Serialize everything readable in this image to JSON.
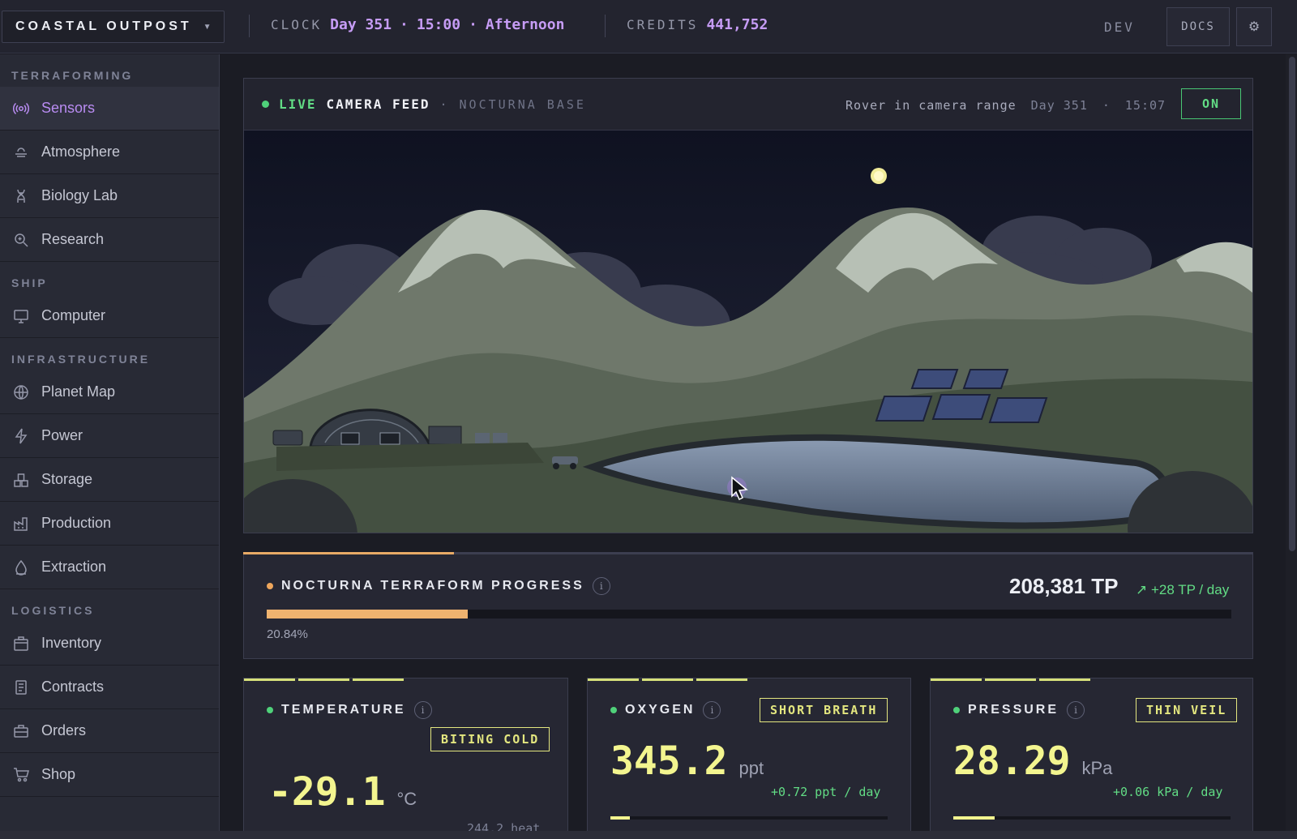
{
  "header": {
    "outpost_name": "COASTAL OUTPOST",
    "clock_label": "CLOCK",
    "clock_day": "Day 351",
    "clock_time": "15:00",
    "clock_period": "Afternoon",
    "credits_label": "CREDITS",
    "credits_value": "441,752",
    "dev_label": "DEV",
    "docs_label": "DOCS"
  },
  "sidebar": {
    "sections": [
      {
        "title": "TERRAFORMING",
        "items": [
          {
            "label": "Sensors",
            "icon": "sensors-icon",
            "active": true
          },
          {
            "label": "Atmosphere",
            "icon": "atmosphere-icon"
          },
          {
            "label": "Biology Lab",
            "icon": "dna-icon"
          },
          {
            "label": "Research",
            "icon": "research-icon"
          }
        ]
      },
      {
        "title": "SHIP",
        "items": [
          {
            "label": "Computer",
            "icon": "monitor-icon"
          }
        ]
      },
      {
        "title": "INFRASTRUCTURE",
        "items": [
          {
            "label": "Planet Map",
            "icon": "globe-icon"
          },
          {
            "label": "Power",
            "icon": "bolt-icon"
          },
          {
            "label": "Storage",
            "icon": "storage-icon"
          },
          {
            "label": "Production",
            "icon": "factory-icon"
          },
          {
            "label": "Extraction",
            "icon": "drop-icon"
          }
        ]
      },
      {
        "title": "LOGISTICS",
        "items": [
          {
            "label": "Inventory",
            "icon": "box-icon"
          },
          {
            "label": "Contracts",
            "icon": "document-icon"
          },
          {
            "label": "Orders",
            "icon": "orders-icon"
          },
          {
            "label": "Shop",
            "icon": "cart-icon"
          }
        ]
      }
    ]
  },
  "camera": {
    "live_label": "LIVE",
    "feed_label": "CAMERA FEED",
    "separator": "·",
    "base_name": "NOCTURNA BASE",
    "status_text": "Rover in camera range",
    "timestamp_day": "Day 351",
    "timestamp_sep": "·",
    "timestamp_time": "15:07",
    "toggle_label": "ON"
  },
  "progress": {
    "title": "NOCTURNA TERRAFORM PROGRESS",
    "info": "i",
    "value": "208,381 TP",
    "rate": "↗ +28 TP / day",
    "percent_text": "20.84%",
    "percent": 20.84
  },
  "stats": [
    {
      "title": "TEMPERATURE",
      "info": "i",
      "badge": "BITING COLD",
      "value": "-29.1",
      "unit": "°C",
      "rate": "",
      "footer": "244.2 heat",
      "level": 0
    },
    {
      "title": "OXYGEN",
      "info": "i",
      "badge": "SHORT BREATH",
      "value": "345.2",
      "unit": "ppt",
      "rate": "+0.72 ppt / day",
      "footer": "",
      "level": 0.07
    },
    {
      "title": "PRESSURE",
      "info": "i",
      "badge": "THIN VEIL",
      "value": "28.29",
      "unit": "kPa",
      "rate": "+0.06 kPa / day",
      "footer": "",
      "level": 0.15
    }
  ],
  "colors": {
    "accent_purple": "#c69cf5",
    "live_green": "#62dc85",
    "progress_orange": "#efb36f",
    "stat_yellow": "#f3f58f"
  }
}
